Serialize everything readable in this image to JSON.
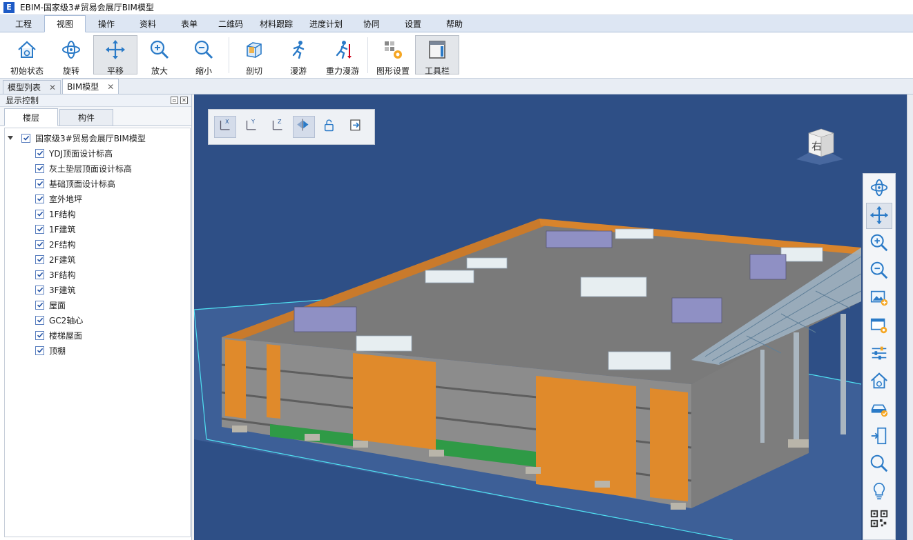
{
  "window": {
    "title": "EBIM-国家级3#贸易会展厅BIM模型",
    "logo_letter": "E"
  },
  "menu": {
    "tabs": [
      "工程",
      "视图",
      "操作",
      "资料",
      "表单",
      "二维码",
      "材料跟踪",
      "进度计划",
      "协同",
      "设置",
      "帮助"
    ],
    "active_index": 1
  },
  "ribbon": {
    "buttons": [
      {
        "label": "初始状态",
        "icon": "home-reset-icon"
      },
      {
        "label": "旋转",
        "icon": "orbit-icon"
      },
      {
        "label": "平移",
        "icon": "pan-icon"
      },
      {
        "label": "放大",
        "icon": "zoom-in-icon"
      },
      {
        "label": "缩小",
        "icon": "zoom-out-icon"
      },
      {
        "label": "剖切",
        "icon": "section-box-icon"
      },
      {
        "label": "漫游",
        "icon": "walk-icon"
      },
      {
        "label": "重力漫游",
        "icon": "gravity-walk-icon"
      },
      {
        "label": "图形设置",
        "icon": "graphics-settings-icon"
      },
      {
        "label": "工具栏",
        "icon": "toolbar-icon"
      }
    ],
    "active": [
      "平移",
      "工具栏"
    ]
  },
  "doc_tabs": [
    {
      "label": "模型列表",
      "close": "✕"
    },
    {
      "label": "BIM模型",
      "close": "✕",
      "active": true
    }
  ],
  "panel": {
    "title": "显示控制",
    "subtabs": [
      "楼层",
      "构件"
    ],
    "tree": {
      "root": "国家级3#贸易会展厅BIM模型",
      "items": [
        "YDJ顶面设计标高",
        "灰土垫层顶面设计标高",
        "基础顶面设计标高",
        "室外地坪",
        "1F结构",
        "1F建筑",
        "2F结构",
        "2F建筑",
        "3F结构",
        "3F建筑",
        "屋面",
        "GC2轴心",
        "楼梯屋面",
        "顶棚"
      ]
    }
  },
  "viewport": {
    "axis_toolbar": [
      {
        "label": "X",
        "icon": "axis-x-icon",
        "active": true
      },
      {
        "label": "Y",
        "icon": "axis-y-icon"
      },
      {
        "label": "Z",
        "icon": "axis-z-icon"
      },
      {
        "label": "",
        "icon": "flip-section-icon",
        "active": true
      },
      {
        "label": "",
        "icon": "unlock-icon"
      },
      {
        "label": "",
        "icon": "exit-icon"
      }
    ],
    "viewcube_face": "右",
    "side_tools": [
      "orbit-icon",
      "pan-icon",
      "zoom-in-icon",
      "zoom-out-icon",
      "image-add-icon",
      "window-settings-icon",
      "sliders-icon",
      "home-icon",
      "vehicle-icon",
      "door-exit-icon",
      "search-icon",
      "bulb-icon",
      "qrcode-icon"
    ],
    "background_color": "#2e4f86",
    "accent_color": "#e08a2b"
  }
}
